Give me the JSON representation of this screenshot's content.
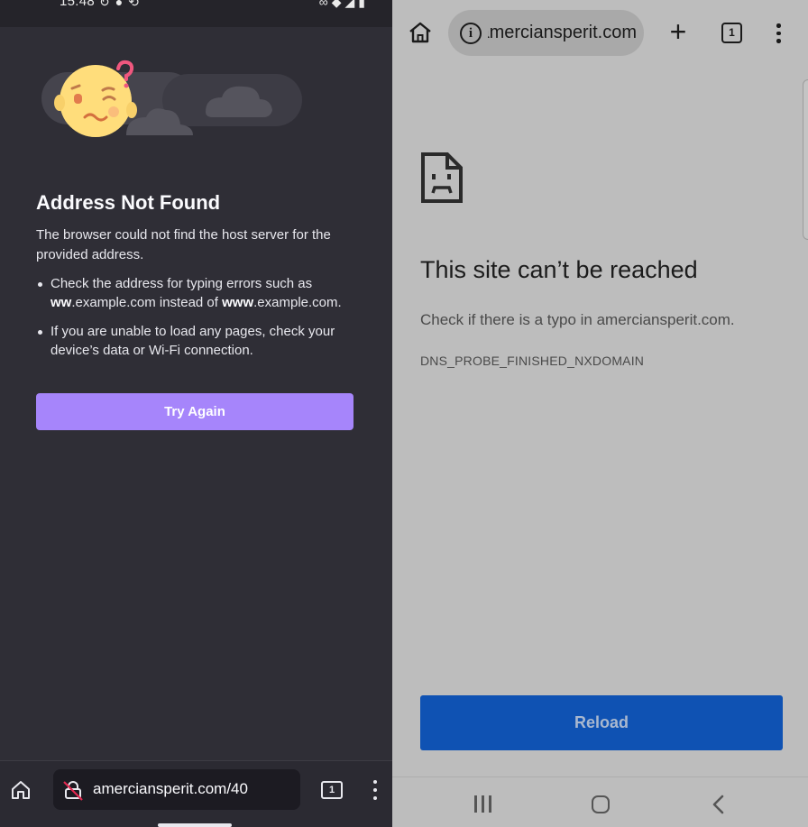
{
  "left": {
    "status": {
      "time": "15:48"
    },
    "error": {
      "title": "Address Not Found",
      "description": "The browser could not find the host server for the provided address.",
      "bullet1": {
        "part1": "Check the address for typing errors such as ",
        "bold1": "ww",
        "part2": ".example.com instead of ",
        "bold2": "www",
        "part3": ".example.com."
      },
      "bullet2": "If you are unable to load any pages, check your device’s data or Wi-Fi connection.",
      "try_again_label": "Try Again"
    },
    "toolbar": {
      "url": "amerciansperit.com/40",
      "tab_count": "1"
    }
  },
  "right": {
    "toolbar": {
      "url": "amerciansperit.com",
      "tab_count": "1"
    },
    "error": {
      "title": "This site can’t be reached",
      "description": "Check if there is a typo in amerciansperit.com.",
      "code": "DNS_PROBE_FINISHED_NXDOMAIN",
      "reload_label": "Reload"
    }
  },
  "colors": {
    "firefox_bg": "#2f2e36",
    "firefox_button": "#a685fb",
    "chrome_bg": "#bdbdbd",
    "chrome_button": "#0f52b3"
  },
  "icons": {
    "left_home": "home-icon",
    "left_lock": "lock-slash-icon",
    "left_tabs": "tab-counter-icon",
    "left_menu": "kebab-menu-icon",
    "right_home": "home-icon",
    "right_info": "info-icon",
    "right_plus": "plus-icon",
    "right_tabs": "tab-switcher-icon",
    "right_menu": "kebab-menu-icon",
    "error_page": "sad-document-icon",
    "nav_recents": "recents-icon",
    "nav_home": "nav-home-icon",
    "nav_back": "back-chevron-icon"
  }
}
